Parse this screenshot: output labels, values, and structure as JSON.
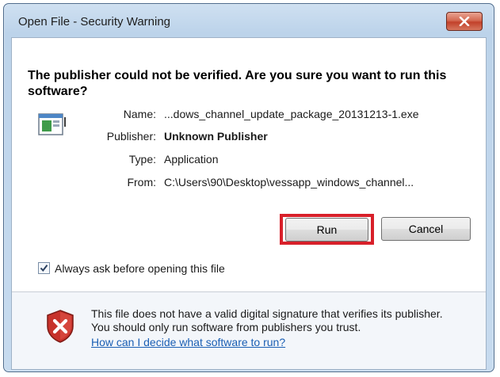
{
  "window": {
    "title": "Open File - Security Warning"
  },
  "dialog": {
    "question": "The publisher could not be verified.  Are you sure you want to run this software?",
    "details": [
      {
        "label": "Name:",
        "value": "...dows_channel_update_package_20131213-1.exe",
        "bold": false
      },
      {
        "label": "Publisher:",
        "value": "Unknown Publisher",
        "bold": true
      },
      {
        "label": "Type:",
        "value": "Application",
        "bold": false
      },
      {
        "label": "From:",
        "value": "C:\\Users\\90\\Desktop\\vessapp_windows_channel...",
        "bold": false
      }
    ],
    "run_label": "Run",
    "cancel_label": "Cancel",
    "always_ask_label": "Always ask before opening this file",
    "always_ask_checked": true,
    "warning_text": "This file does not have a valid digital signature that verifies its publisher.  You should only run software from publishers you trust.",
    "help_link": "How can I decide what software to run?"
  },
  "icons": {
    "close": "close-icon",
    "file": "application-file-icon",
    "shield": "security-shield-icon",
    "check": "checkmark-icon"
  },
  "colors": {
    "highlight": "#d8202a",
    "link": "#1a5fb4"
  }
}
